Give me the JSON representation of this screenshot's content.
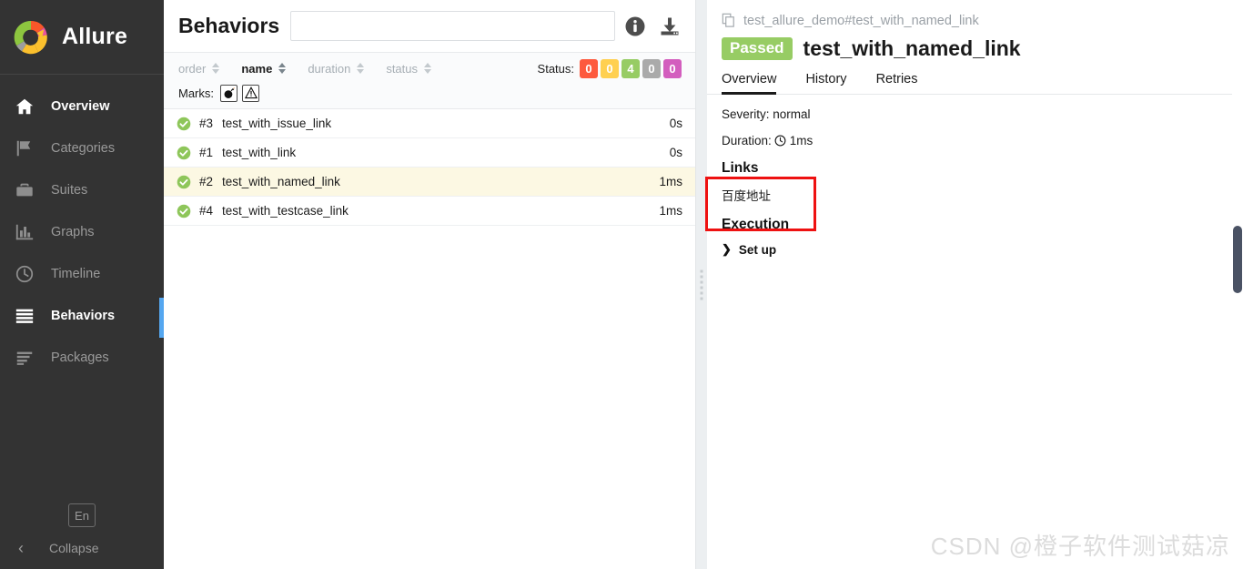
{
  "sidebar": {
    "brand": {
      "name": "Allure",
      "logo_icon": "allure-logo-icon"
    },
    "items": [
      {
        "label": "Overview",
        "icon": "home-icon",
        "active": false
      },
      {
        "label": "Categories",
        "icon": "flag-icon",
        "active": false
      },
      {
        "label": "Suites",
        "icon": "briefcase-icon",
        "active": false
      },
      {
        "label": "Graphs",
        "icon": "bar-chart-icon",
        "active": false
      },
      {
        "label": "Timeline",
        "icon": "clock-icon",
        "active": false
      },
      {
        "label": "Behaviors",
        "icon": "list-icon",
        "active": true
      },
      {
        "label": "Packages",
        "icon": "layers-icon",
        "active": false
      }
    ],
    "language_button": "En",
    "collapse_label": "Collapse",
    "collapse_icon": "chevron-left-icon",
    "active_indicator_color": "#55a7f0"
  },
  "list_panel": {
    "title": "Behaviors",
    "search": {
      "value": "",
      "placeholder": ""
    },
    "header_icons": [
      {
        "name": "info-icon"
      },
      {
        "name": "download-icon"
      }
    ],
    "sorters": [
      {
        "label": "order",
        "active": false
      },
      {
        "label": "name",
        "active": true
      },
      {
        "label": "duration",
        "active": false
      },
      {
        "label": "status",
        "active": false
      }
    ],
    "status_filter": {
      "label": "Status:",
      "chips": [
        {
          "value": "0",
          "color": "#fd5a3e",
          "name": "failed"
        },
        {
          "value": "0",
          "color": "#ffd050",
          "name": "broken"
        },
        {
          "value": "4",
          "color": "#97cc64",
          "name": "passed"
        },
        {
          "value": "0",
          "color": "#aaaaaa",
          "name": "skipped"
        },
        {
          "value": "0",
          "color": "#d35ebe",
          "name": "unknown"
        }
      ]
    },
    "marks_filter": {
      "label": "Marks:",
      "chips": [
        {
          "name": "bomb-icon"
        },
        {
          "name": "warning-triangle-icon"
        }
      ]
    },
    "rows": [
      {
        "status": "passed",
        "order": "#3",
        "name": "test_with_issue_link",
        "duration": "0s",
        "selected": false
      },
      {
        "status": "passed",
        "order": "#1",
        "name": "test_with_link",
        "duration": "0s",
        "selected": false
      },
      {
        "status": "passed",
        "order": "#2",
        "name": "test_with_named_link",
        "duration": "1ms",
        "selected": true
      },
      {
        "status": "passed",
        "order": "#4",
        "name": "test_with_testcase_link",
        "duration": "1ms",
        "selected": false
      }
    ]
  },
  "detail_panel": {
    "breadcrumb": {
      "text": "test_allure_demo#test_with_named_link",
      "icon": "copy-icon"
    },
    "status_badge": {
      "label": "Passed",
      "color": "#97cc64"
    },
    "title": "test_with_named_link",
    "tabs": [
      {
        "label": "Overview",
        "active": true
      },
      {
        "label": "History",
        "active": false
      },
      {
        "label": "Retries",
        "active": false
      }
    ],
    "severity": "Severity: normal",
    "duration_label": "Duration:",
    "duration_value": "1ms",
    "duration_icon": "clock-icon",
    "links_heading": "Links",
    "links": [
      {
        "label": "百度地址"
      }
    ],
    "execution_heading": "Execution",
    "setup_step": {
      "label": "Set up",
      "icon": "chevron-right-icon",
      "expanded": false
    },
    "annotation_box_color": "#ee1111"
  },
  "watermark": "CSDN @橙子软件测试菇凉"
}
